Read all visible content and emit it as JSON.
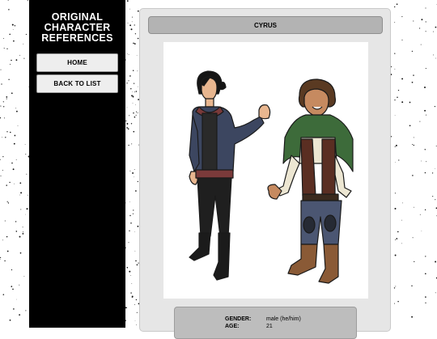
{
  "sidebar": {
    "title_lines": [
      "ORIGINAL",
      "CHARACTER",
      "REFERENCES"
    ],
    "nav": [
      {
        "label": "HOME"
      },
      {
        "label": "BACK TO LIST"
      }
    ]
  },
  "character": {
    "name": "CYRUS",
    "info": [
      {
        "label": "GENDER:",
        "value": "male (he/him)"
      },
      {
        "label": "AGE:",
        "value": "21"
      }
    ]
  },
  "colors": {
    "sidebar_bg": "#000000",
    "panel_bg": "#e6e6e6",
    "header_bg": "#b3b3b3",
    "button_bg": "#eeeeee"
  }
}
